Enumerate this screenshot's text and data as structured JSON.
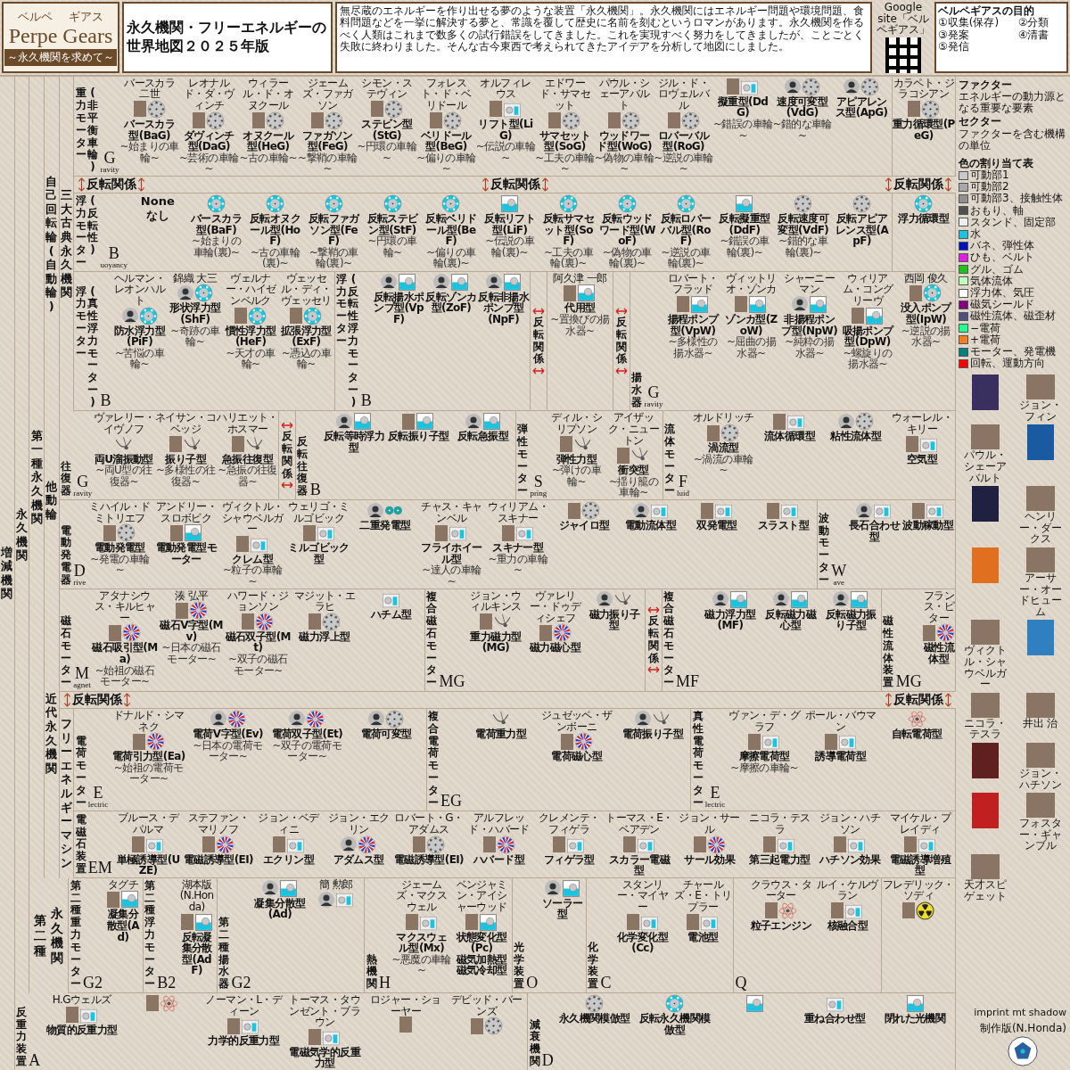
{
  "header": {
    "logo": {
      "ruby_left": "ベルペ",
      "ruby_right": "ギアス",
      "word_left": "Perpe",
      "word_right": "Gears",
      "tagline": "～永久機関を求めて～"
    },
    "title_lines": [
      "永久機関・フリーエネルギーの",
      "世界地図２０２５年版"
    ],
    "intro": "無尽蔵のエネルギーを作り出せる夢のような装置「永久機関」。永久機関にはエネルギー問題や環境問題、食料問題などを一挙に解決する夢と、常識を覆して歴史に名前を刻むというロマンがあります。永久機関を作るべく人類はこれまで数多くの試行錯誤をしてきました。これを実現すべく努力をしてきましたが、ことごとく失敗に終わりました。そんな古今東西で考えられてきたアイデアを分析して地図にしました。",
    "qr_caption": "Google site「ベルペギアス」",
    "goals_title": "ベルペギアスの目的",
    "goals": [
      "①収集(保存)",
      "②分類",
      "③発案",
      "④清書",
      "⑤発信"
    ],
    "terms": [
      {
        "term": "ファクター",
        "meaning": "エネルギーの動力源となる重要な要素"
      },
      {
        "term": "セクター",
        "meaning": "ファクターを含む機構の単位"
      }
    ],
    "legend_title": "色の割り当て表",
    "legend": [
      {
        "label": "可動部1",
        "color": "#c8c8c8"
      },
      {
        "label": "可動部2",
        "color": "#a8a8a8"
      },
      {
        "label": "可動部3、接触性体",
        "color": "#909090"
      },
      {
        "label": "おもり、軸",
        "color": "#505050"
      },
      {
        "label": "スタンド、固定部",
        "color": "#eeeeee"
      },
      {
        "label": "水",
        "color": "#18c4e0"
      },
      {
        "label": "バネ、弾性体",
        "color": "#0010c0"
      },
      {
        "label": "ひも、ベルト",
        "color": "#e020e0"
      },
      {
        "label": "グル、ゴム",
        "color": "#20c020"
      },
      {
        "label": "気体流体",
        "color": "#c0ffc0"
      },
      {
        "label": "浮力体、気圧",
        "color": "#ffffff"
      },
      {
        "label": "磁気シールド",
        "color": "#800080"
      },
      {
        "label": "磁性流体、磁歪材",
        "color": "#505080"
      },
      {
        "label": "−電荷",
        "color": "#20ff90"
      },
      {
        "label": "+電荷",
        "color": "#f08020"
      },
      {
        "label": "モーター、発電機",
        "color": "#008080"
      },
      {
        "label": "回転、運動方向",
        "color": "#ff0000"
      }
    ]
  },
  "side_labels": {
    "outer": "増減機関",
    "perpetual": "永久機関",
    "first_kind": "第一種永久機関",
    "self_rotating": "自己回転輪(自動輪)",
    "classic": "三大古典永久機関",
    "driven": "他動輪",
    "modern": "近代永久機関",
    "free_energy": "フリーエネルギーマシン",
    "second_kind_a": "第二種",
    "second_kind_b": "永久機関"
  },
  "rows": {
    "gravity": [
      {
        "kind": "panel",
        "title": [
          "重力モーター",
          "(非平衡車輪)"
        ],
        "letter": "G",
        "letter_tail": "ravity",
        "items": [
          {
            "person": "バースカラ二世",
            "portrait": {
              "kind": "photo"
            },
            "diagram": {
              "kind": "wheel"
            },
            "name": "バースカラ型(BaG)",
            "nickname": "~始まりの車輪~"
          },
          {
            "person": "レオナルド・ダ・ヴィンチ",
            "portrait": {
              "kind": "photo"
            },
            "diagram": {
              "kind": "wheel"
            },
            "name": "ダヴィンチ型(DaG)",
            "nickname": "~芸術の車輪~"
          },
          {
            "person": "ウィラール・ド・オヌクール",
            "portrait": {
              "kind": "photo"
            },
            "diagram": {
              "kind": "wheel"
            },
            "name": "オヌクール型(HeG)",
            "nickname": "~古の車輪~"
          },
          {
            "person": "ジェームズ・ファガソン",
            "portrait": {
              "kind": "photo"
            },
            "diagram": {
              "kind": "wheel"
            },
            "name": "ファガソン型(FeG)",
            "nickname": "~撃鞘の車輪~"
          },
          {
            "person": "シモン・ステヴィン",
            "portrait": {
              "kind": "photo"
            },
            "diagram": {
              "kind": "wheel"
            },
            "name": "ステビン型(StG)",
            "nickname": "~円環の車輪~"
          },
          {
            "person": "フォレスト・ド・ベリドール",
            "portrait": {
              "kind": "photo"
            },
            "diagram": {
              "kind": "wheel"
            },
            "name": "ベリドール型(BeG)",
            "nickname": "~偏りの車輪~"
          },
          {
            "person": "オルフィレウス",
            "portrait": {
              "kind": "photo"
            },
            "diagram": {
              "kind": "machine"
            },
            "name": "リフト型(LiG)",
            "nickname": "~伝説の車輪~"
          },
          {
            "person": "エドワード・サマセット",
            "portrait": {
              "kind": "photo"
            },
            "diagram": {
              "kind": "wheel"
            },
            "name": "サマセット型(SoG)",
            "nickname": "~工夫の車輪~"
          },
          {
            "person": "パウル・シェーアバルト",
            "portrait": {
              "kind": "photo"
            },
            "diagram": {
              "kind": "wheel"
            },
            "name": "ウッドワード型(WoG)",
            "nickname": "~偽物の車輪~"
          },
          {
            "person": "ジル・ド・ロヴェルバル",
            "portrait": {
              "kind": "photo"
            },
            "diagram": {
              "kind": "wheel"
            },
            "name": "ロバーバル型(RoG)",
            "nickname": "~逆説の車輪~"
          },
          {
            "portrait": {
              "kind": "photo"
            },
            "diagram": {
              "kind": "machine"
            },
            "name": "擬重型(DdG)",
            "nickname": "~錯誤の車輪~"
          },
          {
            "portrait": {
              "kind": "silhouette"
            },
            "diagram": {
              "kind": "wheel"
            },
            "name": "速度可変型(VdG)",
            "nickname": "~錯的な車輪~"
          },
          {
            "portrait": {
              "kind": "silhouette"
            },
            "diagram": {
              "kind": "wheel"
            },
            "name": "アピアレンス型(ApG)"
          }
        ]
      },
      {
        "kind": "panel",
        "items": [
          {
            "person": "カラペト・ジラコシアン",
            "portrait": {
              "kind": "photo"
            },
            "diagram": {
              "kind": "wheel"
            },
            "name": "重力循環型(PeG)"
          }
        ]
      }
    ],
    "flip_1": [
      "反転関係",
      "反転関係",
      "反転関係"
    ],
    "buoyancy": [
      {
        "kind": "panel",
        "title": [
          "浮力モーター",
          "(反転性)"
        ],
        "letter": "B",
        "letter_tail": "uoyancy",
        "items": [
          {
            "diagram": {
              "kind": "none"
            },
            "name": "None",
            "nickname": "なし"
          },
          {
            "diagram": {
              "kind": "wheel-water"
            },
            "name": "バースカラ型(BaF)",
            "nickname": "~始まりの車輪(裏)~"
          },
          {
            "diagram": {
              "kind": "wheel-water"
            },
            "name": "反転オヌクール型(HoF)",
            "nickname": "~古の車輪(裏)~"
          },
          {
            "diagram": {
              "kind": "wheel-water"
            },
            "name": "反転ファガソン型(FeF)",
            "nickname": "~撃鞘の車輪(裏)~"
          },
          {
            "diagram": {
              "kind": "wheel-water"
            },
            "name": "反転ステビン型(StF)",
            "nickname": "~円環の車輪~"
          },
          {
            "diagram": {
              "kind": "wheel-water"
            },
            "name": "反転ベリドール型(BeF)",
            "nickname": "~偏りの車輪(裏)~"
          },
          {
            "diagram": {
              "kind": "tank"
            },
            "name": "反転リフト型(LiF)",
            "nickname": "~伝説の車輪(裏)~"
          },
          {
            "diagram": {
              "kind": "wheel-water"
            },
            "name": "反転サマセット型(SoF)",
            "nickname": "~工夫の車輪(裏)~"
          },
          {
            "diagram": {
              "kind": "wheel-water"
            },
            "name": "反転ウッドワード型(WoF)",
            "nickname": "~偽物の車輪(裏)~"
          },
          {
            "diagram": {
              "kind": "wheel-water"
            },
            "name": "反転ロバーバル型(RoF)",
            "nickname": "~逆説の車輪(裏)~"
          },
          {
            "diagram": {
              "kind": "tank"
            },
            "name": "反転擬重型(DdF)",
            "nickname": "~錯誤の車輪(裏)~"
          },
          {
            "diagram": {
              "kind": "wheel"
            },
            "name": "反転速度可変型(VdF)",
            "nickname": "~錯的な車輪(裏)~"
          },
          {
            "diagram": {
              "kind": "wheel"
            },
            "name": "反転アピアレンス型(ApF)"
          }
        ]
      },
      {
        "kind": "panel",
        "items": [
          {
            "diagram": {
              "kind": "wheel-water"
            },
            "name": "浮力循環型"
          }
        ]
      }
    ],
    "buoyancy_true": [
      {
        "kind": "panel",
        "title": [
          "浮力モーター",
          "(真性浮力モーター)"
        ],
        "letter": "B",
        "items": [
          {
            "person": "ヘルマン・レオンハルト",
            "portrait": {
              "kind": "silhouette"
            },
            "diagram": {
              "kind": "wheel-water"
            },
            "name": "防水浮力型(PiF)",
            "nickname": "~苦悩の車輪~"
          },
          {
            "person": "錦織 大三",
            "portrait": {
              "kind": "silhouette"
            },
            "diagram": {
              "kind": "wheel-water"
            },
            "name": "形状浮力型(ShF)",
            "nickname": "~奇跡の車輪~"
          },
          {
            "person": "ヴェルナー・ハイゼンベルク",
            "portrait": {
              "kind": "photo"
            },
            "diagram": {
              "kind": "wheel-water"
            },
            "name": "慣性浮力型(HeF)",
            "nickname": "~天才の車輪~"
          },
          {
            "person": "ヴェッセル・ディ・ヴェッセリ",
            "portrait": {
              "kind": "photo"
            },
            "diagram": {
              "kind": "wheel-water"
            },
            "name": "拡張浮力型(ExF)",
            "nickname": "~憑込の車輪~"
          }
        ]
      },
      {
        "kind": "panel",
        "title": [
          "浮力モーター",
          "(反転性浮力モーター)"
        ],
        "letter": "B",
        "items": [
          {
            "portrait": {
              "kind": "silhouette"
            },
            "diagram": {
              "kind": "tank"
            },
            "name": "反転揚水ポンプ型(VpF)"
          },
          {
            "portrait": {
              "kind": "silhouette"
            },
            "diagram": {
              "kind": "tank"
            },
            "name": "反転ゾンカ型(ZoF)"
          },
          {
            "portrait": {
              "kind": "silhouette"
            },
            "diagram": {
              "kind": "tank"
            },
            "name": "反転非揚水ポンプ型(NpF)"
          }
        ]
      },
      {
        "kind": "flip",
        "title": "反転関係"
      },
      {
        "kind": "panel",
        "items": [
          {
            "person": "阿久津 一郎",
            "portrait": {
              "kind": "photo"
            },
            "diagram": {
              "kind": "tank"
            },
            "name": "代用型",
            "nickname": "~置換びの揚水器~"
          }
        ]
      },
      {
        "kind": "flip",
        "title": "反転関係"
      },
      {
        "kind": "panel",
        "title": [
          "揚水器"
        ],
        "letter": "G",
        "letter_tail": "ravity",
        "items": [
          {
            "person": "ロバート・フラッド",
            "portrait": {
              "kind": "photo"
            },
            "diagram": {
              "kind": "tank"
            },
            "name": "揚程ポンプ型(VpW)",
            "nickname": "~多様性の揚水器~"
          },
          {
            "person": "ヴィットリオ・ゾンカ",
            "portrait": {
              "kind": "photo"
            },
            "diagram": {
              "kind": "tank"
            },
            "name": "ゾンカ型(ZoW)",
            "nickname": "~屈曲の揚水器~"
          },
          {
            "person": "シャーニーマン",
            "portrait": {
              "kind": "silhouette"
            },
            "diagram": {
              "kind": "tank"
            },
            "name": "非揚程ポンプ型(NpW)",
            "nickname": "~純粋の揚水器~"
          },
          {
            "person": "ウィリアム・コングリーヴ",
            "portrait": {
              "kind": "photo"
            },
            "diagram": {
              "kind": "tank"
            },
            "name": "吸揚ポンプ型(DpW)",
            "nickname": "~螺旋りの揚水器~"
          },
          {
            "person": "西岡 俊久",
            "portrait": {
              "kind": "photo"
            },
            "diagram": {
              "kind": "wheel-water"
            },
            "name": "没入ポンプ型(IpW)",
            "nickname": "~逆説の揚水器~"
          }
        ]
      }
    ],
    "reciprocating": [
      {
        "kind": "panel",
        "title": [
          "往復器"
        ],
        "letter": "G",
        "letter_tail": "ravity",
        "items": [
          {
            "person": "ヴァレリー・イヴノフ",
            "diagram": {
              "kind": "pendulum"
            },
            "name": "両U溜振動型",
            "nickname": "~両U型の往復器~"
          },
          {
            "person": "ネイサン・コベッジ",
            "portrait": {
              "kind": "photo"
            },
            "diagram": {
              "kind": "pendulum"
            },
            "name": "振り子型",
            "nickname": "~多様性の往復器~"
          },
          {
            "person": "ハリエット・ホスマー",
            "portrait": {
              "kind": "photo"
            },
            "diagram": {
              "kind": "pendulum"
            },
            "name": "急振往復型",
            "nickname": "~急振の往復器~"
          }
        ]
      },
      {
        "kind": "flip",
        "title": "反転関係"
      },
      {
        "kind": "panel",
        "title": [
          "反転往復器"
        ],
        "letter": "B",
        "items": [
          {
            "portrait": {
              "kind": "silhouette"
            },
            "diagram": {
              "kind": "tank"
            },
            "name": "反転等時浮力型"
          },
          {
            "portrait": {
              "kind": "photo"
            },
            "diagram": {
              "kind": "tank"
            },
            "name": "反転振り子型"
          },
          {
            "portrait": {
              "kind": "silhouette"
            },
            "diagram": {
              "kind": "tank"
            },
            "name": "反転急振型"
          }
        ]
      },
      {
        "kind": "panel",
        "title": [
          "弾性モーター"
        ],
        "letter": "S",
        "letter_tail": "pring",
        "items": [
          {
            "person": "ディル・シリプソン",
            "portrait": {
              "kind": "photo"
            },
            "diagram": {
              "kind": "pendulum"
            },
            "name": "弾性力型",
            "nickname": "~弾けの車輪~"
          },
          {
            "person": "アイザック・ニュートン",
            "portrait": {
              "kind": "photo"
            },
            "diagram": {
              "kind": "pendulum"
            },
            "name": "衝突型",
            "nickname": "~揺り籠の車輪~"
          }
        ]
      },
      {
        "kind": "panel",
        "title": [
          "流体モーター"
        ],
        "letter": "F",
        "letter_tail": "luid",
        "items": [
          {
            "person": "オルドリッチ",
            "portrait": {
              "kind": "photo"
            },
            "diagram": {
              "kind": "wheel"
            },
            "name": "渦流型",
            "nickname": "~渦流の車輪~"
          },
          {
            "portrait": {
              "kind": "photo"
            },
            "diagram": {
              "kind": "machine"
            },
            "name": "流体循環型"
          },
          {
            "portrait": {
              "kind": "silhouette"
            },
            "diagram": {
              "kind": "wheel"
            },
            "name": "粘性流体型"
          },
          {
            "person": "ウォーレル・キリー",
            "portrait": {
              "kind": "photo"
            },
            "diagram": {
              "kind": "machine"
            },
            "name": "空気型"
          }
        ]
      }
    ],
    "electric_drive": [
      {
        "kind": "panel",
        "title": [
          "電動発電器"
        ],
        "letter": "D",
        "letter_tail": "rive",
        "items": [
          {
            "person": "ミハイル・ドミトリエフ",
            "portrait": {
              "kind": "photo"
            },
            "diagram": {
              "kind": "wheel"
            },
            "name": "電動発電型",
            "nickname": "~発電の車輪~"
          },
          {
            "person": "アンドリー・スロボビク",
            "portrait": {
              "kind": "photo"
            },
            "diagram": {
              "kind": "tank"
            },
            "name": "電動発電型モーター"
          },
          {
            "person": "ヴィクトル・シャウベルガー",
            "portrait": {
              "kind": "photo"
            },
            "diagram": {
              "kind": "machine"
            },
            "name": "クレム型",
            "nickname": "~粒子の車輪~"
          },
          {
            "person": "ウェリゴ・ミルゴビック",
            "portrait": {
              "kind": "photo"
            },
            "diagram": {
              "kind": "machine"
            },
            "name": "ミルゴビック型"
          },
          {
            "portrait": {
              "kind": "silhouette"
            },
            "diagram": {
              "kind": "generator"
            },
            "name": "二重発電型"
          },
          {
            "person": "チャス・キャンベル",
            "portrait": {
              "kind": "photo"
            },
            "diagram": {
              "kind": "machine"
            },
            "name": "フライホイール型",
            "nickname": "~達人の車輪~"
          },
          {
            "person": "ウィリアム・スキナー",
            "portrait": {
              "kind": "photo"
            },
            "diagram": {
              "kind": "machine"
            },
            "name": "スキナー型",
            "nickname": "~重力の車輪~"
          },
          {
            "portrait": {
              "kind": "photo"
            },
            "diagram": {
              "kind": "wheel"
            },
            "name": "ジャイロ型"
          },
          {
            "portrait": {
              "kind": "silhouette"
            },
            "diagram": {
              "kind": "machine"
            },
            "name": "電動流体型"
          },
          {
            "portrait": {
              "kind": "photo"
            },
            "diagram": {
              "kind": "machine"
            },
            "name": "双発電型"
          },
          {
            "portrait": {
              "kind": "photo"
            },
            "diagram": {
              "kind": "machine"
            },
            "name": "スラスト型"
          }
        ]
      },
      {
        "kind": "panel",
        "title": [
          "波動モーター"
        ],
        "letter": "W",
        "letter_tail": "ave",
        "items": [
          {
            "portrait": {
              "kind": "silhouette"
            },
            "diagram": {
              "kind": "machine"
            },
            "name": "長石合わせ型"
          },
          {
            "portrait": {
              "kind": "photo"
            },
            "diagram": {
              "kind": "machine"
            },
            "name": "波動稼動型"
          }
        ]
      }
    ],
    "magnet": [
      {
        "kind": "panel",
        "title": [
          "磁石モーター"
        ],
        "letter": "M",
        "letter_tail": "agnet",
        "items": [
          {
            "person": "アタナシウス・キルヒャー",
            "portrait": {
              "kind": "photo"
            },
            "diagram": {
              "kind": "coil"
            },
            "name": "磁石吸引型(Ma)",
            "nickname": "~始祖の磁石モーター~"
          },
          {
            "person": "湊 弘平",
            "portrait": {
              "kind": "photo"
            },
            "diagram": {
              "kind": "coil"
            },
            "name": "磁石V字型(Mv)",
            "nickname": "~日本の磁石モーター~"
          },
          {
            "person": "ハワード・ジョンソン",
            "portrait": {
              "kind": "photo"
            },
            "diagram": {
              "kind": "coil"
            },
            "name": "磁石双子型(Mt)",
            "nickname": "~双子の磁石モーター~"
          },
          {
            "person": "マジット・エラヒ",
            "portrait": {
              "kind": "photo"
            },
            "diagram": {
              "kind": "wheel"
            },
            "name": "磁力浮上型"
          },
          {
            "diagram": {
              "kind": "machine"
            },
            "name": "ハチム型"
          }
        ]
      },
      {
        "kind": "panel",
        "title": [
          "複合磁石モーター"
        ],
        "letter": "MG",
        "items": [
          {
            "person": "ジョン・ウィルキンス",
            "portrait": {
              "kind": "photo"
            },
            "diagram": {
              "kind": "pendulum"
            },
            "name": "重力磁力型(MG)"
          },
          {
            "person": "ヴァレリー・ドゥディシェフ",
            "portrait": {
              "kind": "photo"
            },
            "diagram": {
              "kind": "coil"
            },
            "name": "磁力磁心型"
          },
          {
            "portrait": {
              "kind": "silhouette"
            },
            "diagram": {
              "kind": "pendulum"
            },
            "name": "磁力振り子型"
          }
        ]
      },
      {
        "kind": "flip",
        "title": "反転関係"
      },
      {
        "kind": "panel",
        "title": [
          "複合磁石モーター"
        ],
        "letter": "MF",
        "items": [
          {
            "portrait": {
              "kind": "silhouette"
            },
            "diagram": {
              "kind": "tank"
            },
            "name": "磁力浮力型(MF)"
          },
          {
            "portrait": {
              "kind": "silhouette"
            },
            "diagram": {
              "kind": "tank"
            },
            "name": "反転磁力磁心型"
          },
          {
            "portrait": {
              "kind": "silhouette"
            },
            "diagram": {
              "kind": "tank"
            },
            "name": "反転磁力振り子型"
          }
        ]
      },
      {
        "kind": "panel",
        "title": [
          "磁性流体装置"
        ],
        "letter": "MG",
        "items": [
          {
            "person": "フランス・ピター",
            "portrait": {
              "kind": "photo"
            },
            "diagram": {
              "kind": "coil"
            },
            "name": "磁性流体型"
          }
        ]
      }
    ],
    "flip_2": [
      "反転関係",
      "反転関係"
    ],
    "electric": [
      {
        "kind": "panel",
        "title": [
          "電荷モーター"
        ],
        "letter": "E",
        "letter_tail": "lectric",
        "items": [
          {
            "person": "ドナルド・シマネク",
            "portrait": {
              "kind": "photo"
            },
            "diagram": {
              "kind": "coil"
            },
            "name": "電荷引力型(Ea)",
            "nickname": "~始祖の電荷モーター~"
          },
          {
            "portrait": {
              "kind": "silhouette"
            },
            "diagram": {
              "kind": "coil"
            },
            "name": "電荷V字型(Ev)",
            "nickname": "~日本の電荷モーター~"
          },
          {
            "portrait": {
              "kind": "silhouette"
            },
            "diagram": {
              "kind": "coil"
            },
            "name": "電荷双子型(Et)",
            "nickname": "~双子の電荷モーター~"
          },
          {
            "portrait": {
              "kind": "silhouette"
            },
            "diagram": {
              "kind": "wheel"
            },
            "name": "電荷可変型"
          }
        ]
      },
      {
        "kind": "panel",
        "title": [
          "複合電荷モーター"
        ],
        "letter": "EG",
        "items": [
          {
            "diagram": {
              "kind": "pendulum"
            },
            "name": "電荷重力型"
          },
          {
            "person": "ジュゼッペ・ザンボーニ",
            "portrait": {
              "kind": "photo"
            },
            "diagram": {
              "kind": "coil"
            },
            "name": "電荷磁心型"
          },
          {
            "portrait": {
              "kind": "silhouette"
            },
            "diagram": {
              "kind": "pendulum"
            },
            "name": "電荷振り子型"
          }
        ]
      },
      {
        "kind": "panel",
        "title": [
          "真性電荷モーター"
        ],
        "letter": "E",
        "letter_tail": "lectric",
        "items": [
          {
            "person": "ヴァン・デ・グラフ",
            "portrait": {
              "kind": "photo"
            },
            "diagram": {
              "kind": "machine"
            },
            "name": "摩擦電荷型",
            "nickname": "~摩擦の車輪~"
          },
          {
            "person": "ポール・バウマン",
            "portrait": {
              "kind": "photo"
            },
            "diagram": {
              "kind": "machine"
            },
            "name": "誘導電荷型"
          },
          {
            "diagram": {
              "kind": "atom"
            },
            "name": "自転電荷型"
          }
        ]
      }
    ],
    "free_energy": [
      {
        "kind": "panel",
        "title": [
          "電磁石装置"
        ],
        "letter": "EM",
        "items": [
          {
            "person": "ブルース・デパルマ",
            "portrait": {
              "kind": "photo"
            },
            "diagram": {
              "kind": "machine"
            },
            "name": "単極誘導型(UZE)"
          },
          {
            "person": "ステファン・マリノフ",
            "portrait": {
              "kind": "photo"
            },
            "diagram": {
              "kind": "coil"
            },
            "name": "電磁誘導型(EI)"
          },
          {
            "person": "ジョン・ベディニ",
            "portrait": {
              "kind": "photo"
            },
            "diagram": {
              "kind": "machine"
            },
            "name": "エクリン型"
          },
          {
            "person": "ジョン・エクリン",
            "portrait": {
              "kind": "silhouette"
            },
            "diagram": {
              "kind": "coil"
            },
            "name": "アダムス型"
          },
          {
            "person": "ロバート・G・アダムス",
            "portrait": {
              "kind": "photo"
            },
            "diagram": {
              "kind": "wheel"
            },
            "name": "電磁誘導型(EI)"
          },
          {
            "person": "アルフレッド・ハバード",
            "portrait": {
              "kind": "photo"
            },
            "diagram": {
              "kind": "coil"
            },
            "name": "ハバード型"
          },
          {
            "person": "クレメンテ・フィゲラ",
            "portrait": {
              "kind": "photo"
            },
            "diagram": {
              "kind": "machine"
            },
            "name": "フィゲラ型"
          },
          {
            "person": "トーマス・E・ベアデン",
            "portrait": {
              "kind": "photo"
            },
            "diagram": {
              "kind": "machine"
            },
            "name": "スカラー電磁型"
          },
          {
            "person": "ジョン・サール",
            "portrait": {
              "kind": "photo"
            },
            "diagram": {
              "kind": "coil"
            },
            "name": "サール効果"
          },
          {
            "person": "ニコラ・テスラ",
            "portrait": {
              "kind": "photo"
            },
            "diagram": {
              "kind": "machine"
            },
            "name": "第三起電力型"
          },
          {
            "person": "ジョン・ハチソン",
            "portrait": {
              "kind": "photo"
            },
            "diagram": {
              "kind": "machine"
            },
            "name": "ハチソン効果"
          },
          {
            "person": "マイケル・プレイディ",
            "portrait": {
              "kind": "photo"
            },
            "diagram": {
              "kind": "machine"
            },
            "name": "電磁誘導増殖型"
          }
        ]
      }
    ],
    "second_kind": [
      {
        "kind": "panel",
        "title": [
          "第二種重力モーター"
        ],
        "letter": "G2",
        "items": [
          {
            "person": "タグチ",
            "portrait": {
              "kind": "photo"
            },
            "diagram": {
              "kind": "tank"
            },
            "name": "凝集分散型(Ad)"
          }
        ]
      },
      {
        "kind": "panel",
        "title": [
          "第二種浮力モーター"
        ],
        "letter": "B2",
        "items": [
          {
            "person": "湖本版(N.Honda)",
            "portrait": {
              "kind": "photo"
            },
            "diagram": {
              "kind": "tank"
            },
            "name": "反転凝集分散型(AdF)"
          }
        ]
      },
      {
        "kind": "panel",
        "title": [
          "第二種揚水器"
        ],
        "letter": "G2",
        "items": [
          {
            "portrait": {
              "kind": "silhouette"
            },
            "diagram": {
              "kind": "tank"
            },
            "name": "凝集分散型(Ad)"
          },
          {
            "person": "簡 勲郎",
            "portrait": {
              "kind": "silhouette"
            },
            "diagram": {
              "kind": "machine"
            }
          }
        ]
      },
      {
        "kind": "panel",
        "title": [
          "熱機関"
        ],
        "letter": "H",
        "items": [
          {
            "person": "ジェームズ・マクスウェル",
            "portrait": {
              "kind": "photo"
            },
            "diagram": {
              "kind": "machine"
            },
            "name": "マクスウェル型(Mx)",
            "nickname": "~悪魔の車輪~"
          },
          {
            "person": "ベンジャミン・アイシャーウッド",
            "portrait": {
              "kind": "photo"
            },
            "diagram": {
              "kind": "tank"
            },
            "name": "状態変化型(Pc)",
            "notes": [
              "磁気加熱型",
              "磁気冷却型"
            ]
          }
        ]
      },
      {
        "kind": "panel",
        "title": [
          "光学装置"
        ],
        "letter": "O",
        "items": [
          {
            "portrait": {
              "kind": "silhouette"
            },
            "diagram": {
              "kind": "tank"
            },
            "name": "ソーラー型"
          }
        ]
      },
      {
        "kind": "panel",
        "title": [
          "化学装置"
        ],
        "letter": "C",
        "items": [
          {
            "person": "スタンリー・マイヤー",
            "portrait": {
              "kind": "photo"
            },
            "diagram": {
              "kind": "machine"
            },
            "name": "化学変化型(Cc)"
          },
          {
            "person": "チャールズ・E・トリプラー",
            "portrait": {
              "kind": "photo"
            },
            "diagram": {
              "kind": "machine"
            },
            "name": "電池型"
          }
        ]
      },
      {
        "kind": "panel",
        "letter": "Q",
        "items": [
          {
            "person": "クラウス・ターター",
            "portrait": {
              "kind": "photo"
            },
            "diagram": {
              "kind": "atom"
            },
            "name": "粒子エンジン"
          },
          {
            "person": "ルイ・ケルヴラン",
            "portrait": {
              "kind": "photo"
            },
            "diagram": {
              "kind": "machine"
            },
            "name": "核融合型"
          }
        ]
      },
      {
        "kind": "panel",
        "items": [
          {
            "person": "フレデリック・ソディ",
            "portrait": {
              "kind": "photo"
            },
            "diagram": {
              "kind": "radiation"
            }
          }
        ]
      }
    ],
    "bottom": [
      {
        "kind": "panel",
        "title": [
          "反重力装置"
        ],
        "letter": "A",
        "items": [
          {
            "person": "H.Gウェルズ",
            "portrait": {
              "kind": "photo"
            },
            "diagram": {
              "kind": "machine"
            },
            "name": "物質的反重力型"
          },
          {
            "portrait": {
              "kind": "photo"
            },
            "diagram": {
              "kind": "atom"
            }
          },
          {
            "person": "ノーマン・L・ディーン",
            "portrait": {
              "kind": "photo"
            },
            "diagram": {
              "kind": "machine"
            },
            "name": "力学的反重力型"
          },
          {
            "person": "トーマス・タウンゼント・ブラウン",
            "portrait": {
              "kind": "photo"
            },
            "diagram": {
              "kind": "machine"
            },
            "name": "電磁気学的反重力型"
          },
          {
            "person": "ロジャー・ショーヤー",
            "portrait": {
              "kind": "photo"
            },
            "diagram": {
              "kind": "none"
            }
          },
          {
            "person": "デビッド・バーンズ",
            "portrait": {
              "kind": "photo"
            },
            "diagram": {
              "kind": "wheel"
            }
          }
        ]
      },
      {
        "kind": "panel",
        "title": [
          "減衰機関"
        ],
        "letter": "D",
        "items": [
          {
            "diagram": {
              "kind": "wheel"
            },
            "name": "永久機関模倣型"
          },
          {
            "diagram": {
              "kind": "wheel-water"
            },
            "name": "反転永久機関模倣型"
          },
          {
            "diagram": {
              "kind": "tank"
            }
          },
          {
            "diagram": {
              "kind": "machine"
            },
            "name": "重ね合わせ型"
          },
          {
            "diagram": {
              "kind": "tank"
            },
            "name": "閉れた光機関"
          }
        ]
      }
    ]
  },
  "sidebar": [
    {
      "kind": "book",
      "color": "#3a3060"
    },
    {
      "kind": "portrait",
      "name": "ジョン・フィン"
    },
    {
      "kind": "portrait",
      "name": "パウル・シェーアバルト"
    },
    {
      "kind": "book",
      "color": "#1a5aa0"
    },
    {
      "kind": "book",
      "color": "#202040"
    },
    {
      "kind": "portrait",
      "name": "ヘンリー・ダークス"
    },
    {
      "kind": "book",
      "color": "#e07020"
    },
    {
      "kind": "portrait",
      "name": "アーサー・オードヒューム"
    },
    {
      "kind": "portrait",
      "name": "ヴィクトル・シャウベルガー"
    },
    {
      "kind": "book",
      "color": "#3080c0"
    },
    {
      "kind": "portrait",
      "name": "ニコラ・テスラ"
    },
    {
      "kind": "portrait",
      "name": "井出 治"
    },
    {
      "kind": "book",
      "color": "#602020"
    },
    {
      "kind": "portrait",
      "name": "ジョン・ハチソン"
    },
    {
      "kind": "book",
      "color": "#c02020"
    },
    {
      "kind": "portrait",
      "name": "フォスター・ギャンブル"
    },
    {
      "kind": "portrait",
      "name": "天才スピゲェット"
    }
  ],
  "footer": {
    "credit": "制作版(N.Honda)",
    "imprint": "imprint mt shadow"
  }
}
